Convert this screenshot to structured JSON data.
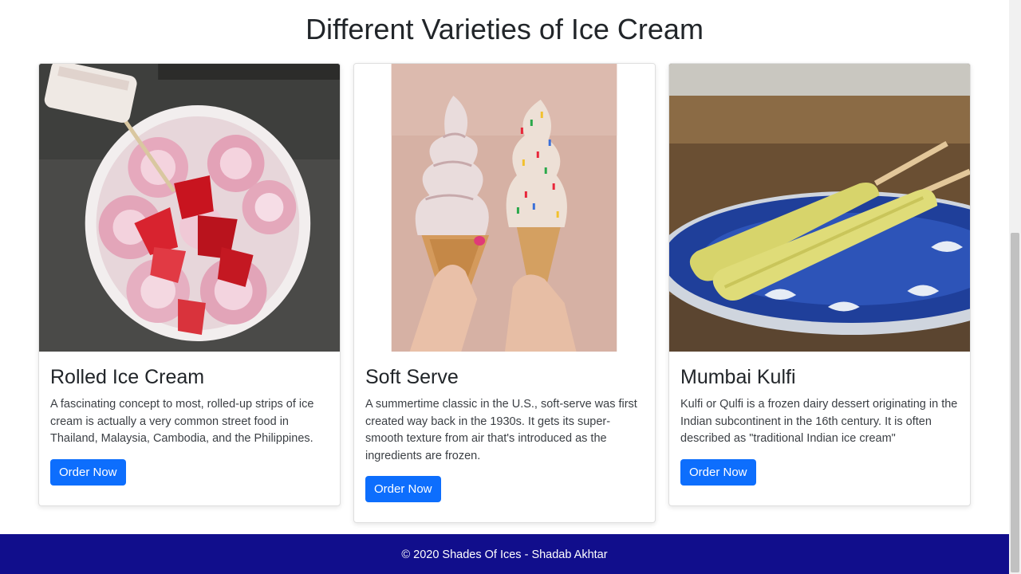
{
  "page": {
    "title": "Different Varieties of Ice Cream"
  },
  "cards": [
    {
      "title": "Rolled Ice Cream",
      "text": "A fascinating concept to most, rolled-up strips of ice cream is actually a very common street food in Thailand, Malaysia, Cambodia, and the Philippines.",
      "button": "Order Now",
      "image": "rolled-ice-cream-photo"
    },
    {
      "title": "Soft Serve",
      "text": "A summertime classic in the U.S., soft-serve was first created way back in the 1930s. It gets its super-smooth texture from air that's introduced as the ingredients are frozen.",
      "button": "Order Now",
      "image": "soft-serve-cones-photo"
    },
    {
      "title": "Mumbai Kulfi",
      "text": "Kulfi or Qulfi is a frozen dairy dessert originating in the Indian subcontinent in the 16th century. It is often described as \"traditional Indian ice cream\"",
      "button": "Order Now",
      "image": "mumbai-kulfi-photo"
    }
  ],
  "footer": {
    "text": "© 2020 Shades Of Ices - Shadab Akhtar"
  },
  "colors": {
    "button": "#0d6efd",
    "footer_bg": "#110e8c",
    "text": "#212529"
  }
}
